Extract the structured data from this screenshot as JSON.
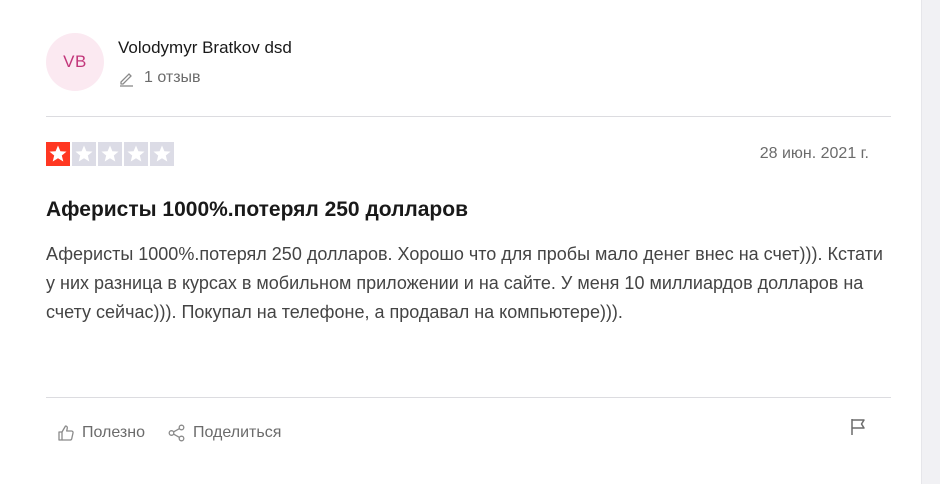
{
  "author": {
    "initials": "VB",
    "name": "Volodymyr Bratkov dsd",
    "review_count": "1 отзыв",
    "avatar_bg": "#fbe9f1",
    "avatar_fg": "#c2367a"
  },
  "review": {
    "rating": 1,
    "max_rating": 5,
    "star_color": "#ff3722",
    "date": "28 июн. 2021 г.",
    "title": "Аферисты 1000%.потерял 250 долларов",
    "text": "Аферисты 1000%.потерял 250 долларов. Хорошо что для пробы мало денег внес на счет))). Кстати у них разница в курсах в мобильном приложении и на сайте. У меня 10 миллиардов долларов на счету сейчас))). Покупал на телефоне, а продавал на компьютере)))."
  },
  "actions": {
    "useful_label": "Полезно",
    "share_label": "Поделиться",
    "useful_icon": "thumbs-up-icon",
    "share_icon": "share-icon",
    "report_icon": "flag-icon"
  }
}
